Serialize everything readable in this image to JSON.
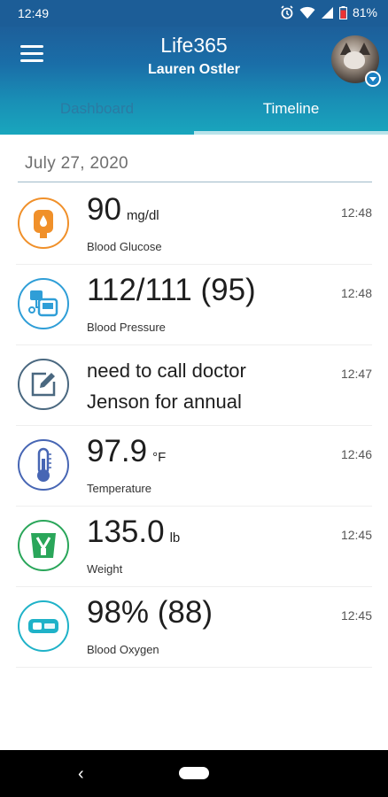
{
  "status": {
    "time": "12:49",
    "battery": "81%"
  },
  "header": {
    "title": "Life365",
    "user": "Lauren Ostler"
  },
  "tabs": [
    {
      "label": "Dashboard",
      "active": false
    },
    {
      "label": "Timeline",
      "active": true
    }
  ],
  "colors": {
    "header_top": "#1d5f9a",
    "header_bottom": "#19a6bd",
    "glucose": "#f0902a",
    "pressure": "#2f9ed7",
    "note": "#4a6880",
    "temperature": "#4766b4",
    "weight": "#2aa65a",
    "oxygen": "#1fb2c8"
  },
  "timeline": {
    "date": "July 27, 2020",
    "entries": [
      {
        "icon": "blood-glucose-icon",
        "value": "90",
        "unit": "mg/dl",
        "label": "Blood Glucose",
        "time": "12:48"
      },
      {
        "icon": "blood-pressure-icon",
        "value": "112/111 (95)",
        "unit": "",
        "label": "Blood Pressure",
        "time": "12:48"
      },
      {
        "icon": "note-icon",
        "line1": "need to call doctor",
        "line2": "Jenson for annual",
        "time": "12:47"
      },
      {
        "icon": "thermometer-icon",
        "value": "97.9",
        "unit": "°F",
        "label": "Temperature",
        "time": "12:46"
      },
      {
        "icon": "scale-icon",
        "value": "135.0",
        "unit": "lb",
        "label": "Weight",
        "time": "12:45"
      },
      {
        "icon": "pulse-oximeter-icon",
        "value": "98% (88)",
        "unit": "",
        "label": "Blood Oxygen",
        "time": "12:45"
      }
    ]
  },
  "navbar": {
    "back_glyph": "‹"
  }
}
